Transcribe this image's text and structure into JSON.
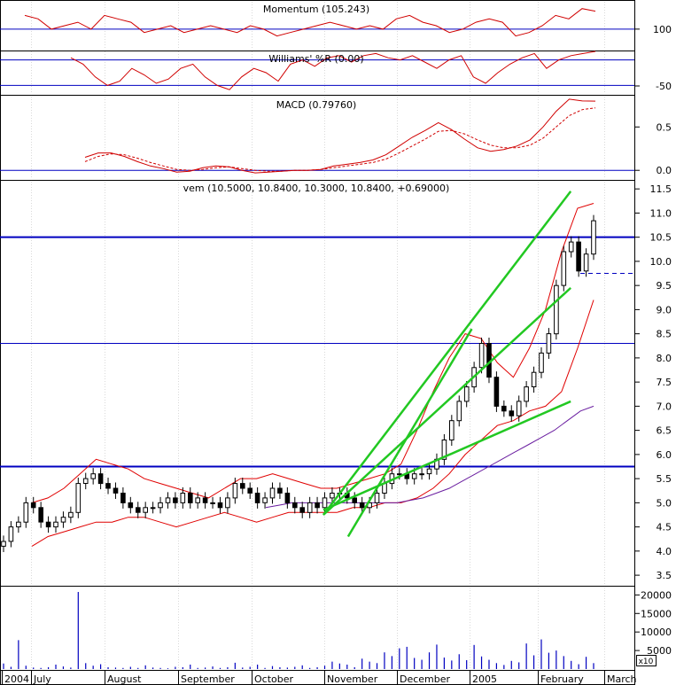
{
  "colors": {
    "price_up": "#ffffff",
    "price_down": "#000000",
    "bollinger": "#e00000",
    "moving_average_short": "#a0a0a0",
    "moving_average_long": "#6a1ea0",
    "trendline": "#22c822",
    "level_line": "#0000c0",
    "volume": "#0000c0",
    "indicator_line": "#d00000"
  },
  "chart_data": [
    {
      "type": "line",
      "panel": "momentum",
      "title": "Momentum (105.243)",
      "y_ticks": [
        "100"
      ],
      "reference_line": 100,
      "series": [
        {
          "values": [
            104,
            103,
            100,
            101,
            102,
            100,
            104,
            103,
            102,
            99,
            100,
            101,
            99,
            100,
            101,
            100,
            99,
            101,
            100,
            98,
            99,
            100,
            101,
            102,
            101,
            100,
            101,
            100,
            103,
            104,
            102,
            101,
            99,
            100,
            102,
            103,
            102,
            98,
            99,
            101,
            104,
            103,
            106,
            105.243
          ]
        }
      ]
    },
    {
      "type": "line",
      "panel": "williams_r",
      "title": "Williams' %R (0.00)",
      "y_ticks": [
        "-50"
      ],
      "reference_lines": [
        -20,
        -80
      ],
      "series": [
        {
          "values": [
            -15,
            -30,
            -60,
            -80,
            -70,
            -40,
            -55,
            -75,
            -65,
            -40,
            -30,
            -60,
            -80,
            -90,
            -60,
            -40,
            -50,
            -70,
            -30,
            -20,
            -35,
            -15,
            -10,
            -25,
            -10,
            -5,
            -15,
            -20,
            -10,
            -25,
            -40,
            -20,
            -10,
            -60,
            -75,
            -50,
            -30,
            -15,
            -5,
            -40,
            -20,
            -10,
            -5,
            0
          ]
        }
      ]
    },
    {
      "type": "line",
      "panel": "macd",
      "title": "MACD (0.79760)",
      "y_ticks": [
        "0.5",
        "0.0"
      ],
      "ylim": [
        -0.1,
        0.85
      ],
      "series": [
        {
          "values": [
            0.15,
            0.2,
            0.2,
            0.16,
            0.1,
            0.05,
            0.02,
            -0.02,
            -0.01,
            0.03,
            0.05,
            0.04,
            0.0,
            -0.03,
            -0.02,
            -0.01,
            0.0,
            0.0,
            0.01,
            0.05,
            0.07,
            0.09,
            0.12,
            0.18,
            0.28,
            0.38,
            0.46,
            0.55,
            0.47,
            0.36,
            0.26,
            0.22,
            0.24,
            0.28,
            0.35,
            0.5,
            0.68,
            0.82,
            0.8,
            0.7976
          ]
        },
        {
          "values": [
            0.1,
            0.16,
            0.19,
            0.18,
            0.14,
            0.09,
            0.05,
            0.01,
            0.0,
            0.01,
            0.03,
            0.04,
            0.02,
            0.0,
            -0.01,
            -0.01,
            0.0,
            0.0,
            0.01,
            0.03,
            0.05,
            0.07,
            0.09,
            0.13,
            0.2,
            0.28,
            0.36,
            0.45,
            0.46,
            0.42,
            0.35,
            0.29,
            0.26,
            0.26,
            0.29,
            0.37,
            0.5,
            0.63,
            0.7,
            0.72
          ]
        }
      ]
    },
    {
      "type": "candlestick",
      "panel": "price",
      "title": "vem (10.5000, 10.8400, 10.3000, 10.8400, +0.69000)",
      "ylim": [
        3.3,
        11.65
      ],
      "y_ticks": [
        "11.5",
        "11.0",
        "10.5",
        "10.0",
        "9.5",
        "9.0",
        "8.5",
        "8.0",
        "7.5",
        "7.0",
        "6.5",
        "6.0",
        "5.5",
        "5.0",
        "4.5",
        "4.0",
        "3.5"
      ],
      "horizontal_levels": [
        10.5,
        8.3,
        5.75
      ],
      "dashed_level": 9.75,
      "close": [
        4.2,
        4.5,
        4.6,
        5.0,
        4.9,
        4.6,
        4.5,
        4.6,
        4.7,
        4.8,
        5.4,
        5.5,
        5.6,
        5.4,
        5.3,
        5.2,
        5.0,
        4.9,
        4.8,
        4.9,
        4.9,
        5.0,
        5.1,
        5.0,
        5.2,
        5.0,
        5.1,
        5.0,
        5.0,
        4.9,
        5.1,
        5.4,
        5.3,
        5.2,
        5.0,
        5.1,
        5.3,
        5.2,
        5.0,
        4.9,
        4.8,
        5.0,
        4.9,
        5.1,
        5.2,
        5.2,
        5.1,
        5.0,
        4.9,
        5.0,
        5.2,
        5.4,
        5.6,
        5.6,
        5.5,
        5.6,
        5.6,
        5.7,
        5.9,
        6.3,
        6.7,
        7.1,
        7.4,
        7.8,
        8.3,
        7.6,
        7.0,
        6.9,
        6.8,
        7.1,
        7.4,
        7.7,
        8.1,
        8.5,
        9.5,
        10.2,
        10.4,
        9.8,
        10.15,
        10.84
      ],
      "upper_band": [
        5.0,
        5.1,
        5.3,
        5.6,
        5.9,
        5.8,
        5.7,
        5.5,
        5.4,
        5.3,
        5.2,
        5.1,
        5.3,
        5.5,
        5.5,
        5.6,
        5.5,
        5.4,
        5.3,
        5.3,
        5.4,
        5.5,
        5.6,
        5.8,
        6.5,
        7.3,
        8.0,
        8.5,
        8.4,
        7.9,
        7.6,
        8.2,
        9.0,
        10.2,
        11.1,
        11.2
      ],
      "lower_band": [
        4.1,
        4.3,
        4.4,
        4.5,
        4.6,
        4.6,
        4.7,
        4.7,
        4.6,
        4.5,
        4.6,
        4.7,
        4.8,
        4.7,
        4.6,
        4.7,
        4.8,
        4.8,
        4.8,
        4.8,
        4.9,
        4.9,
        5.0,
        5.0,
        5.1,
        5.3,
        5.6,
        6.0,
        6.3,
        6.6,
        6.7,
        6.9,
        7.0,
        7.3,
        8.2,
        9.2
      ],
      "moving_average_long": [
        4.9,
        4.95,
        5.0,
        5.0,
        5.0,
        5.0,
        5.0,
        5.0,
        5.0,
        5.0,
        5.0,
        5.05,
        5.1,
        5.2,
        5.3,
        5.45,
        5.6,
        5.75,
        5.9,
        6.05,
        6.2,
        6.35,
        6.5,
        6.7,
        6.9,
        7.0
      ],
      "trendlines": [
        {
          "from": [
            0.52,
            4.75
          ],
          "to": [
            0.92,
            11.45
          ]
        },
        {
          "from": [
            0.52,
            4.75
          ],
          "to": [
            0.92,
            9.45
          ]
        },
        {
          "from": [
            0.56,
            4.3
          ],
          "to": [
            0.76,
            8.6
          ]
        },
        {
          "from": [
            0.52,
            4.85
          ],
          "to": [
            0.92,
            7.1
          ]
        }
      ]
    },
    {
      "type": "bar",
      "panel": "volume",
      "y_ticks": [
        "20000",
        "15000",
        "10000",
        "5000"
      ],
      "ylim": [
        0,
        22000
      ],
      "unit_box": "x10",
      "values": [
        1500,
        600,
        7800,
        900,
        400,
        300,
        500,
        1200,
        700,
        400,
        20800,
        1600,
        900,
        1300,
        500,
        400,
        300,
        600,
        300,
        1000,
        400,
        300,
        200,
        600,
        500,
        1200,
        300,
        400,
        700,
        300,
        500,
        1700,
        400,
        600,
        1200,
        300,
        800,
        500,
        400,
        600,
        1000,
        300,
        500,
        900,
        2000,
        1500,
        1200,
        500,
        2800,
        2000,
        1600,
        4500,
        3500,
        5600,
        6000,
        3000,
        2500,
        4500,
        6600,
        3100,
        2300,
        4000,
        2400,
        6500,
        3400,
        2500,
        1600,
        1100,
        2200,
        1800,
        6900,
        3700,
        8000,
        4400,
        5000,
        3500,
        2200,
        1300,
        3300,
        1600
      ]
    }
  ],
  "x_axis": {
    "labels": [
      "2004",
      "July",
      "August",
      "September",
      "October",
      "November",
      "December",
      "2005",
      "February",
      "March"
    ]
  }
}
